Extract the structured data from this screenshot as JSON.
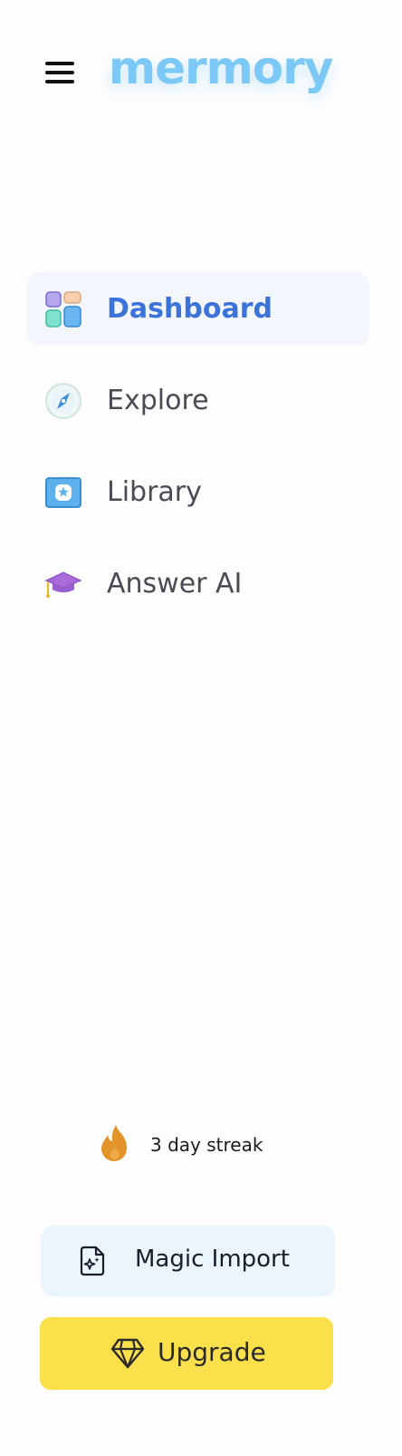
{
  "header": {
    "logo_text": "mermory",
    "menu_icon": "hamburger-menu-icon"
  },
  "nav": {
    "items": [
      {
        "label": "Dashboard",
        "icon": "dashboard-grid-icon",
        "active": true
      },
      {
        "label": "Explore",
        "icon": "compass-icon",
        "active": false
      },
      {
        "label": "Library",
        "icon": "library-star-icon",
        "active": false
      },
      {
        "label": "Answer AI",
        "icon": "graduation-cap-icon",
        "active": false
      }
    ]
  },
  "streak": {
    "text": "3 day streak",
    "icon": "flame-icon"
  },
  "actions": {
    "magic_import_label": "Magic Import",
    "magic_import_icon": "magic-file-icon",
    "upgrade_label": "Upgrade",
    "upgrade_icon": "diamond-icon"
  },
  "colors": {
    "logo": "#7cc8f6",
    "active_nav_text": "#3b73db",
    "active_nav_bg": "#f3f6fd",
    "magic_import_bg": "#eaf5fd",
    "upgrade_bg": "#fbdf4b"
  }
}
